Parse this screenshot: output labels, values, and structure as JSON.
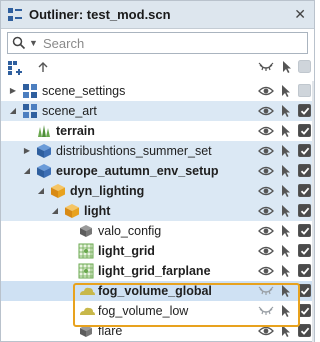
{
  "window": {
    "title": "Outliner: test_mod.scn",
    "close_glyph": "✕"
  },
  "search": {
    "placeholder": "Search",
    "value": ""
  },
  "toolbar": {
    "icons": [
      "add-hierarchy-icon",
      "sort-icon",
      "visibility-header-icon",
      "select-header-icon",
      "enable-header-icon"
    ]
  },
  "colors": {
    "accent_blue": "#3d6fb5",
    "selection_row": "#dbe8f4",
    "highlight_box": "#e8a21e",
    "terrain_green": "#6aa84f",
    "cluster_orange": "#e8a21e",
    "fog_yellow": "#c8b84a"
  },
  "tree": [
    {
      "label": "scene_settings",
      "depth": 0,
      "expand": "collapsed",
      "icon": "scene-blocks-icon",
      "bold": false,
      "eye": "open",
      "checked": false
    },
    {
      "label": "scene_art",
      "depth": 0,
      "expand": "expanded",
      "icon": "scene-blocks-icon",
      "bold": false,
      "eye": "open",
      "checked": true
    },
    {
      "label": "terrain",
      "depth": 1,
      "expand": "none",
      "icon": "terrain-icon",
      "bold": true,
      "eye": "open",
      "checked": true
    },
    {
      "label": "distribushtions_summer_set",
      "depth": 1,
      "expand": "collapsed",
      "icon": "cube-blue-icon",
      "bold": false,
      "eye": "open",
      "checked": true
    },
    {
      "label": "europe_autumn_env_setup",
      "depth": 1,
      "expand": "expanded",
      "icon": "cube-blue-icon",
      "bold": true,
      "eye": "open",
      "checked": true
    },
    {
      "label": "dyn_lighting",
      "depth": 2,
      "expand": "expanded",
      "icon": "cube-orange-icon",
      "bold": true,
      "eye": "open",
      "checked": true
    },
    {
      "label": "light",
      "depth": 3,
      "expand": "expanded",
      "icon": "cube-orange-icon",
      "bold": true,
      "eye": "open",
      "checked": true
    },
    {
      "label": "valo_config",
      "depth": 4,
      "expand": "none",
      "icon": "cube-gray-icon",
      "bold": false,
      "eye": "open",
      "checked": true
    },
    {
      "label": "light_grid",
      "depth": 4,
      "expand": "none",
      "icon": "grid-icon",
      "bold": true,
      "eye": "open",
      "checked": true
    },
    {
      "label": "light_grid_farplane",
      "depth": 4,
      "expand": "none",
      "icon": "grid-icon",
      "bold": true,
      "eye": "open",
      "checked": true
    },
    {
      "label": "fog_volume_global",
      "depth": 4,
      "expand": "none",
      "icon": "fog-icon",
      "bold": true,
      "eye": "hidden",
      "checked": true
    },
    {
      "label": "fog_volume_low",
      "depth": 4,
      "expand": "none",
      "icon": "fog-icon",
      "bold": false,
      "eye": "hidden",
      "checked": true
    },
    {
      "label": "flare",
      "depth": 4,
      "expand": "none",
      "icon": "cube-gray-icon",
      "bold": false,
      "eye": "open",
      "checked": true
    }
  ]
}
